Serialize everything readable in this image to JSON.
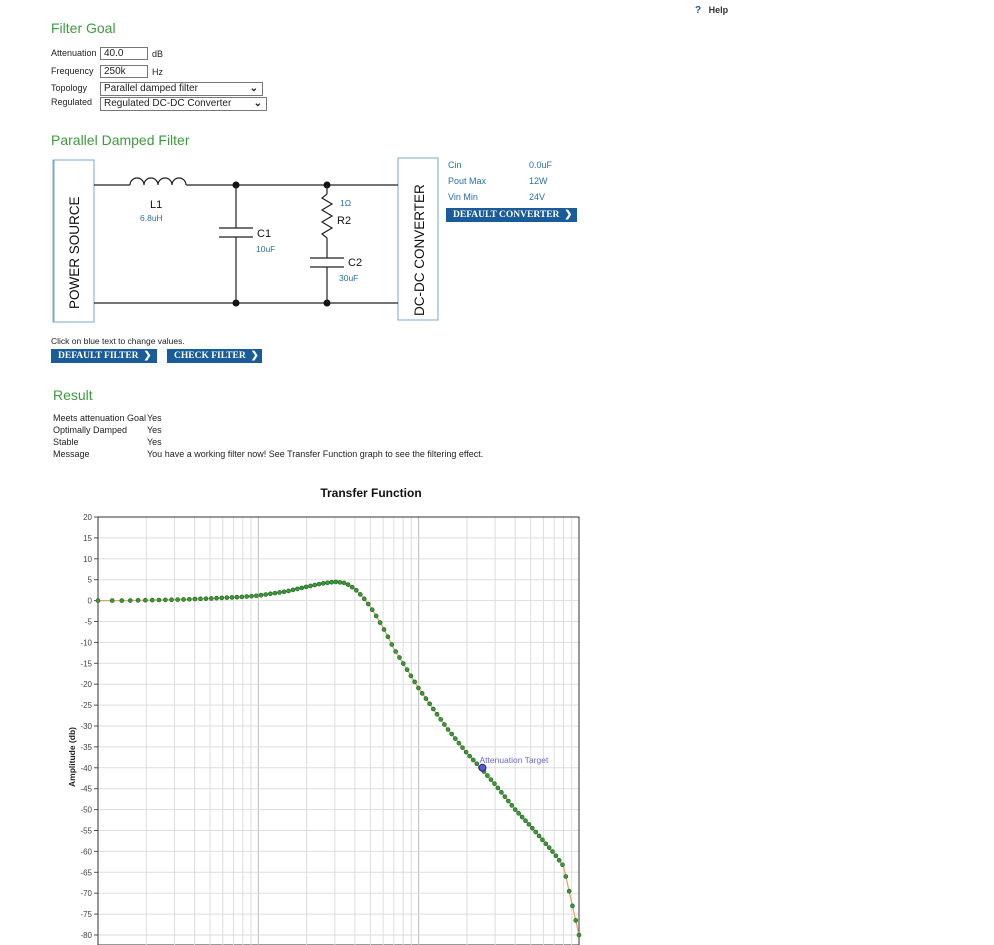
{
  "help": {
    "label": "Help",
    "icon": "question-icon"
  },
  "filter_goal": {
    "heading": "Filter Goal",
    "attenuation": {
      "label": "Attenuation",
      "value": "40.0",
      "unit": "dB"
    },
    "frequency": {
      "label": "Frequency",
      "value": "250k",
      "unit": "Hz"
    },
    "topology": {
      "label": "Topology",
      "value": "Parallel damped filter"
    },
    "regulated": {
      "label": "Regulated",
      "value": "Regulated DC-DC Converter"
    }
  },
  "filter": {
    "heading": "Parallel Damped Filter",
    "power_source": "POWER SOURCE",
    "converter": "DC-DC CONVERTER",
    "L1": {
      "name": "L1",
      "value": "6.8uH"
    },
    "C1": {
      "name": "C1",
      "value": "10uF"
    },
    "R2": {
      "name": "R2",
      "value": "1Ω"
    },
    "C2": {
      "name": "C2",
      "value": "30uF"
    },
    "hint": "Click on blue text to change values.",
    "default_filter": "DEFAULT FILTER",
    "check_filter": "CHECK FILTER"
  },
  "converter_params": {
    "rows": [
      {
        "label": "Cin",
        "value": "0.0uF"
      },
      {
        "label": "Pout Max",
        "value": "12W"
      },
      {
        "label": "Vin Min",
        "value": "24V"
      }
    ],
    "default_button": "DEFAULT CONVERTER"
  },
  "result": {
    "heading": "Result",
    "rows": [
      {
        "label": "Meets attenuation Goal",
        "value": "Yes"
      },
      {
        "label": "Optimally Damped",
        "value": "Yes"
      },
      {
        "label": "Stable",
        "value": "Yes"
      },
      {
        "label": "Message",
        "value": "You have a working filter now! See Transfer Function graph to see the filtering effect."
      }
    ]
  },
  "colors": {
    "heading": "#3f9a3f",
    "button": "#1a5c99",
    "link": "#2a6fa8",
    "target": "#3a3aa8",
    "curve": "#2a8a2a"
  },
  "chart_data": {
    "type": "line",
    "title": "Transfer Function",
    "ylabel": "Amplitude (db)",
    "xlabel": "",
    "ylim": [
      -80,
      20
    ],
    "yticks": [
      20,
      15,
      10,
      5,
      0,
      -5,
      -10,
      -15,
      -20,
      -25,
      -30,
      -35,
      -40,
      -45,
      -50,
      -55,
      -60,
      -65,
      -70,
      -75,
      -80
    ],
    "x_scale": "log",
    "xlim": [
      1000,
      1000000
    ],
    "grid": true,
    "series": [
      {
        "x": [
          1000,
          1500,
          2000,
          3000,
          5000,
          8000,
          10000,
          15000,
          20000,
          25000,
          30000,
          35000,
          40000,
          45000,
          50000,
          55000,
          60000,
          65000,
          70000,
          80000,
          100000,
          150000,
          200000,
          250000,
          300000,
          400000,
          500000,
          600000,
          700000,
          800000,
          1000000
        ],
        "y": [
          0,
          0,
          0.1,
          0.2,
          0.5,
          0.9,
          1.2,
          2.2,
          3.3,
          4.1,
          4.5,
          4.2,
          2.8,
          0.8,
          -1.5,
          -4,
          -6.5,
          -9,
          -11.5,
          -15,
          -21,
          -30.5,
          -36.5,
          -40.5,
          -44,
          -50,
          -54,
          -57.5,
          -60.5,
          -63.5,
          -80
        ]
      }
    ],
    "annotations": [
      {
        "label": "Attenuation Target",
        "x": 250000,
        "y": -40
      }
    ]
  }
}
